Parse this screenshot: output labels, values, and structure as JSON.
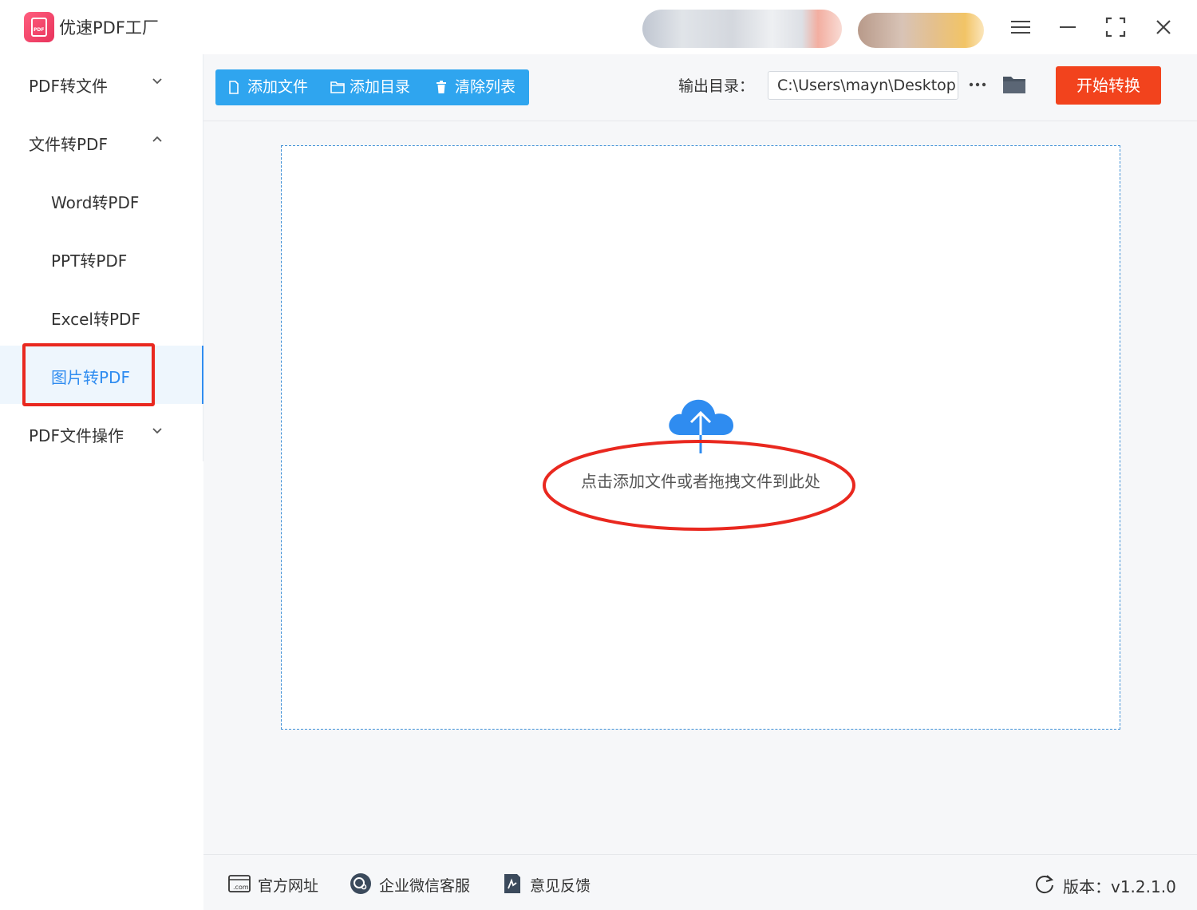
{
  "app": {
    "title": "优速PDF工厂",
    "logo_text": "PDF"
  },
  "window_controls": {
    "menu_icon": "hamburger-icon",
    "minimize_icon": "minimize-icon",
    "maximize_icon": "fullscreen-icon",
    "close_icon": "close-icon"
  },
  "sidebar": {
    "items": [
      {
        "label": "PDF转文件",
        "type": "group",
        "expanded": false
      },
      {
        "label": "文件转PDF",
        "type": "group",
        "expanded": true
      },
      {
        "label": "Word转PDF",
        "type": "sub"
      },
      {
        "label": "PPT转PDF",
        "type": "sub"
      },
      {
        "label": "Excel转PDF",
        "type": "sub"
      },
      {
        "label": "图片转PDF",
        "type": "sub",
        "active": true
      },
      {
        "label": "PDF文件操作",
        "type": "group",
        "expanded": false
      }
    ]
  },
  "toolbar": {
    "add_file": "添加文件",
    "add_folder": "添加目录",
    "clear_list": "清除列表",
    "output_label": "输出目录：",
    "output_path": "C:\\Users\\mayn\\Desktop",
    "more_label": "···",
    "start": "开始转换"
  },
  "dropzone": {
    "text": "点击添加文件或者拖拽文件到此处",
    "icon": "cloud-upload-icon"
  },
  "footer": {
    "website": "官方网址",
    "wechat": "企业微信客服",
    "feedback": "意见反馈",
    "version": "版本：v1.2.1.0"
  },
  "colors": {
    "accent": "#2f8cf0",
    "toolbar_blue": "#2fa5ef",
    "start_red": "#f2431d",
    "annotation_red": "#e9281f"
  }
}
